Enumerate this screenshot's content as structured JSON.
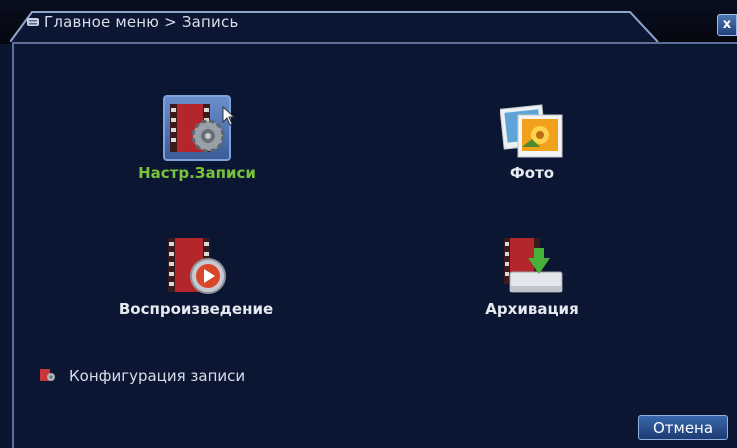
{
  "header": {
    "breadcrumb": "Главное меню > Запись"
  },
  "close_label": "x",
  "menu": {
    "items": [
      {
        "label": "Настр.Записи",
        "icon": "record-settings-icon",
        "selected": true
      },
      {
        "label": "Фото",
        "icon": "photo-icon",
        "selected": false
      },
      {
        "label": "Воспроизведение",
        "icon": "playback-icon",
        "selected": false
      },
      {
        "label": "Архивация",
        "icon": "backup-icon",
        "selected": false
      }
    ]
  },
  "config": {
    "label": "Конфигурация  записи",
    "icon": "record-config-icon"
  },
  "footer": {
    "cancel_label": "Отмена"
  },
  "colors": {
    "background": "#0b1633",
    "active_label": "#79c23b",
    "label": "#e6e9ef",
    "button": "#2a5296"
  }
}
